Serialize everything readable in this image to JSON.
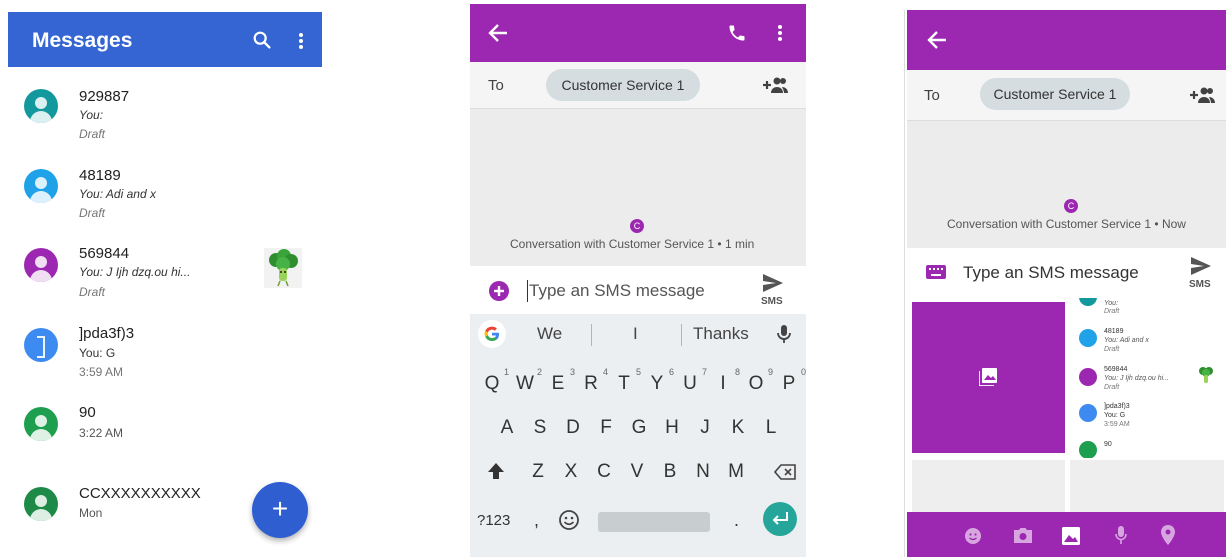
{
  "colors": {
    "blue_bar": "#3565d3",
    "purple": "#9c27b0",
    "fab": "#2e5ed0",
    "teal": "#26a69a"
  },
  "panel1": {
    "title": "Messages",
    "fab_label": "+",
    "conversations": [
      {
        "name": "929887",
        "line2": "You:",
        "line3": "Draft",
        "avatar_color": "#13989e",
        "italic": true
      },
      {
        "name": "48189",
        "line2": "You: Adi and x",
        "line3": "Draft",
        "avatar_color": "#1fa2e8",
        "italic": true
      },
      {
        "name": "569844",
        "line2": "You: J Ijh dzq.ou hi...",
        "line3": "Draft",
        "avatar_color": "#9c27b0",
        "italic": true
      },
      {
        "name": "]pda3f)3",
        "line2": "You: G",
        "line3": "3:59 AM",
        "avatar_color": "#3d8bf0",
        "italic": false
      },
      {
        "name": "90",
        "line2": "3:22 AM",
        "line3": "",
        "avatar_color": "#1e9e4f",
        "italic": false
      },
      {
        "name": "CCXXXXXXXXXX",
        "line2": "Mon",
        "line3": "",
        "avatar_color": "#1e8a47",
        "italic": false
      }
    ]
  },
  "panel2": {
    "to_label": "To",
    "recipient": "Customer Service 1",
    "avatar_letter": "C",
    "caption": "Conversation with Customer Service 1 • 1 min",
    "compose_placeholder": "Type an SMS message",
    "sms_label": "SMS",
    "suggestions": [
      "We",
      "I",
      "Thanks"
    ],
    "row1": [
      "Q",
      "W",
      "E",
      "R",
      "T",
      "Y",
      "U",
      "I",
      "O",
      "P"
    ],
    "row1_hints": [
      "1",
      "2",
      "3",
      "4",
      "5",
      "6",
      "7",
      "8",
      "9",
      "0"
    ],
    "row2": [
      "A",
      "S",
      "D",
      "F",
      "G",
      "H",
      "J",
      "K",
      "L"
    ],
    "row3": [
      "Z",
      "X",
      "C",
      "V",
      "B",
      "N",
      "M"
    ],
    "sym_key": "?123",
    "comma_key": ",",
    "period_key": "."
  },
  "panel3": {
    "to_label": "To",
    "recipient": "Customer Service 1",
    "avatar_letter": "C",
    "caption": "Conversation with Customer Service 1 • Now",
    "compose_placeholder": "Type an SMS message",
    "sms_label": "SMS",
    "mini_list": [
      {
        "name": "You:",
        "line2": "Draft",
        "avatar_color": "#13989e"
      },
      {
        "name": "48189",
        "line2": "You: Adi and x",
        "line3": "Draft",
        "avatar_color": "#1fa2e8"
      },
      {
        "name": "569844",
        "line2": "You: J Ijh dzq.ou hi...",
        "line3": "Draft",
        "avatar_color": "#9c27b0"
      },
      {
        "name": "]pda3f)3",
        "line2": "You: G",
        "line3": "3:59 AM",
        "avatar_color": "#3d8bf0"
      },
      {
        "name": "90",
        "avatar_color": "#1e9e4f"
      }
    ]
  }
}
